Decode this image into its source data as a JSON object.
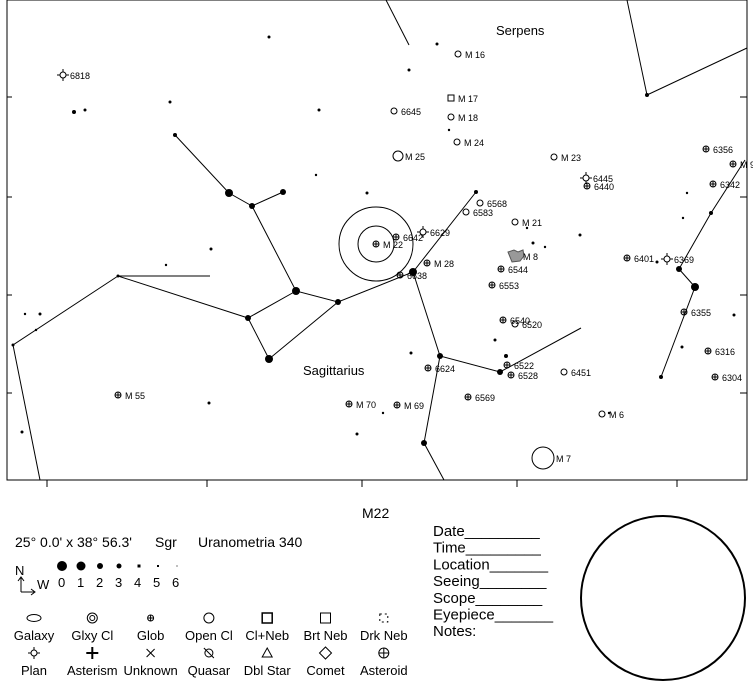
{
  "chart": {
    "constellations": [
      "Serpens",
      "Sagittarius"
    ],
    "objects": [
      {
        "label": "6818",
        "type": "planetary"
      },
      {
        "label": "M 16",
        "type": "open"
      },
      {
        "label": "M 17",
        "type": "clneb"
      },
      {
        "label": "M 18",
        "type": "open"
      },
      {
        "label": "6645",
        "type": "open"
      },
      {
        "label": "M 24",
        "type": "open"
      },
      {
        "label": "M 25",
        "type": "open"
      },
      {
        "label": "M 23",
        "type": "open"
      },
      {
        "label": "6356",
        "type": "glob"
      },
      {
        "label": "M 9",
        "type": "glob"
      },
      {
        "label": "6342",
        "type": "glob"
      },
      {
        "label": "6445",
        "type": "planetary"
      },
      {
        "label": "6440",
        "type": "glob"
      },
      {
        "label": "6568",
        "type": "open"
      },
      {
        "label": "6583",
        "type": "open"
      },
      {
        "label": "M 21",
        "type": "open"
      },
      {
        "label": "6642",
        "type": "glob"
      },
      {
        "label": "6629",
        "type": "planetary"
      },
      {
        "label": "M 22",
        "type": "glob"
      },
      {
        "label": "M 28",
        "type": "glob"
      },
      {
        "label": "M 8",
        "type": "nebula"
      },
      {
        "label": "6544",
        "type": "glob"
      },
      {
        "label": "6553",
        "type": "glob"
      },
      {
        "label": "6638",
        "type": "glob"
      },
      {
        "label": "6540",
        "type": "glob"
      },
      {
        "label": "6520",
        "type": "open"
      },
      {
        "label": "6401",
        "type": "glob"
      },
      {
        "label": "6369",
        "type": "planetary"
      },
      {
        "label": "6355",
        "type": "glob"
      },
      {
        "label": "6316",
        "type": "glob"
      },
      {
        "label": "6304",
        "type": "glob"
      },
      {
        "label": "6522",
        "type": "glob"
      },
      {
        "label": "6528",
        "type": "glob"
      },
      {
        "label": "6451",
        "type": "open"
      },
      {
        "label": "6624",
        "type": "glob"
      },
      {
        "label": "M 55",
        "type": "glob"
      },
      {
        "label": "M 70",
        "type": "glob"
      },
      {
        "label": "M 69",
        "type": "glob"
      },
      {
        "label": "6569",
        "type": "glob"
      },
      {
        "label": "M 6",
        "type": "open"
      },
      {
        "label": "M 7",
        "type": "open"
      }
    ]
  },
  "info": {
    "target": "M22",
    "field": "25° 0.0' x 38° 56.3'",
    "constellation": "Sgr",
    "atlas": "Uranometria 340"
  },
  "compass": {
    "north": "N",
    "west": "W"
  },
  "magnitudes": [
    "0",
    "1",
    "2",
    "3",
    "4",
    "5",
    "6"
  ],
  "legend": [
    "Galaxy",
    "Glxy Cl",
    "Glob",
    "Open Cl",
    "Cl+Neb",
    "Brt Neb",
    "Drk Neb",
    "Plan",
    "Asterism",
    "Unknown",
    "Quasar",
    "Dbl Star",
    "Comet",
    "Asteroid"
  ],
  "log": [
    "Date_________",
    "Time_________",
    "Location_______",
    "Seeing________",
    "Scope________",
    "Eyepiece_______",
    "Notes:"
  ]
}
